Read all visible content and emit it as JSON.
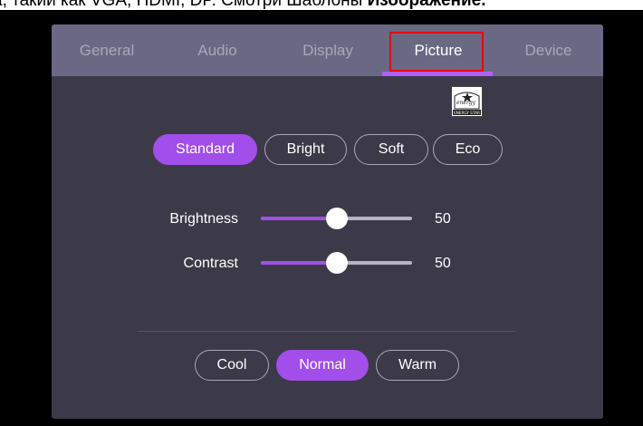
{
  "caption": {
    "prefix": "а, такий как VGA, HDMI, DP. Смотри Шаблоны ",
    "bold": "Изображение."
  },
  "tabs": [
    {
      "label": "General"
    },
    {
      "label": "Audio"
    },
    {
      "label": "Display"
    },
    {
      "label": "Picture",
      "active": true
    },
    {
      "label": "Device"
    }
  ],
  "energy_star": {
    "label": "ENERGY STAR",
    "script": "energy"
  },
  "picture_modes": [
    {
      "label": "Standard",
      "selected": true
    },
    {
      "label": "Bright"
    },
    {
      "label": "Soft"
    },
    {
      "label": "Eco"
    }
  ],
  "sliders": [
    {
      "label": "Brightness",
      "value": "50",
      "level": 0.5
    },
    {
      "label": "Contrast",
      "value": "50",
      "level": 0.5
    }
  ],
  "color_temps": [
    {
      "label": "Cool"
    },
    {
      "label": "Normal",
      "selected": true
    },
    {
      "label": "Warm"
    }
  ],
  "colors": {
    "accent": "#a24eea",
    "panel": "#3c3a48",
    "tabbar": "#6b6883",
    "highlight": "#ee0000"
  }
}
